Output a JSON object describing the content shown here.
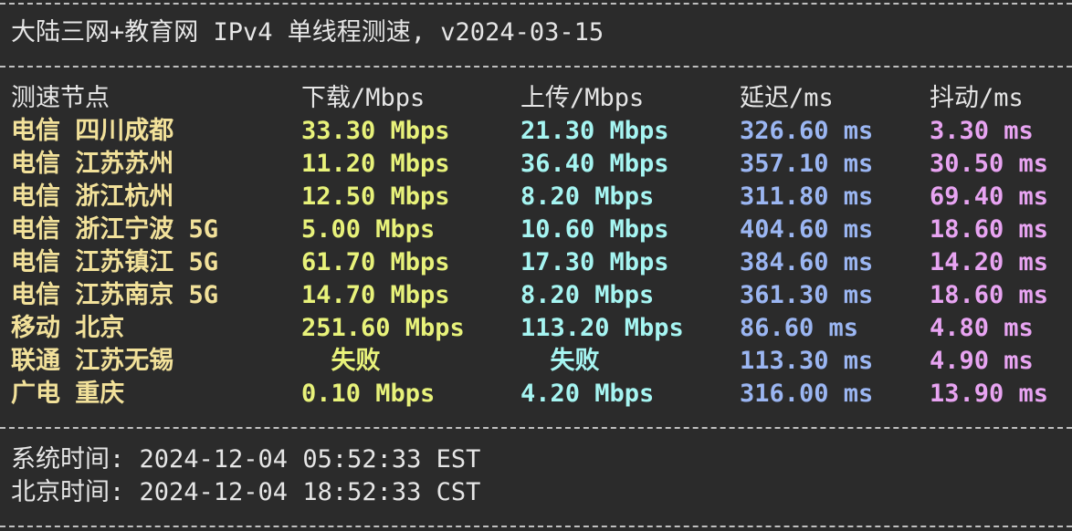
{
  "title": "大陆三网+教育网 IPv4 单线程测速, v2024-03-15",
  "headers": {
    "node": "测速节点",
    "download": "下载/Mbps",
    "upload": "上传/Mbps",
    "latency": "延迟/ms",
    "jitter": "抖动/ms"
  },
  "rows": [
    {
      "node": "电信 四川成都",
      "download": "33.30 Mbps",
      "upload": "21.30 Mbps",
      "latency": "326.60 ms",
      "jitter": "3.30 ms"
    },
    {
      "node": "电信 江苏苏州",
      "download": "11.20 Mbps",
      "upload": "36.40 Mbps",
      "latency": "357.10 ms",
      "jitter": "30.50 ms"
    },
    {
      "node": "电信 浙江杭州",
      "download": "12.50 Mbps",
      "upload": "8.20 Mbps",
      "latency": "311.80 ms",
      "jitter": "69.40 ms"
    },
    {
      "node": "电信 浙江宁波 5G",
      "download": "5.00 Mbps",
      "upload": "10.60 Mbps",
      "latency": "404.60 ms",
      "jitter": "18.60 ms"
    },
    {
      "node": "电信 江苏镇江 5G",
      "download": "61.70 Mbps",
      "upload": "17.30 Mbps",
      "latency": "384.60 ms",
      "jitter": "14.20 ms"
    },
    {
      "node": "电信 江苏南京 5G",
      "download": "14.70 Mbps",
      "upload": "8.20 Mbps",
      "latency": "361.30 ms",
      "jitter": "18.60 ms"
    },
    {
      "node": "移动 北京",
      "download": "251.60 Mbps",
      "upload": "113.20 Mbps",
      "latency": "86.60 ms",
      "jitter": "4.80 ms"
    },
    {
      "node": "联通 江苏无锡",
      "download": "  失败",
      "upload": "  失败",
      "latency": "113.30 ms",
      "jitter": "4.90 ms"
    },
    {
      "node": "广电 重庆",
      "download": "0.10 Mbps",
      "upload": "4.20 Mbps",
      "latency": "316.00 ms",
      "jitter": "13.90 ms"
    }
  ],
  "footer": {
    "system_time": "系统时间: 2024-12-04 05:52:33 EST",
    "beijing_time": "北京时间: 2024-12-04 18:52:33 CST"
  },
  "colors": {
    "background": "#2b2b2b",
    "node": "#f2e19a",
    "download": "#e8f27a",
    "upload": "#a6f5f2",
    "latency": "#9bb6f2",
    "jitter": "#e8a4f2"
  }
}
